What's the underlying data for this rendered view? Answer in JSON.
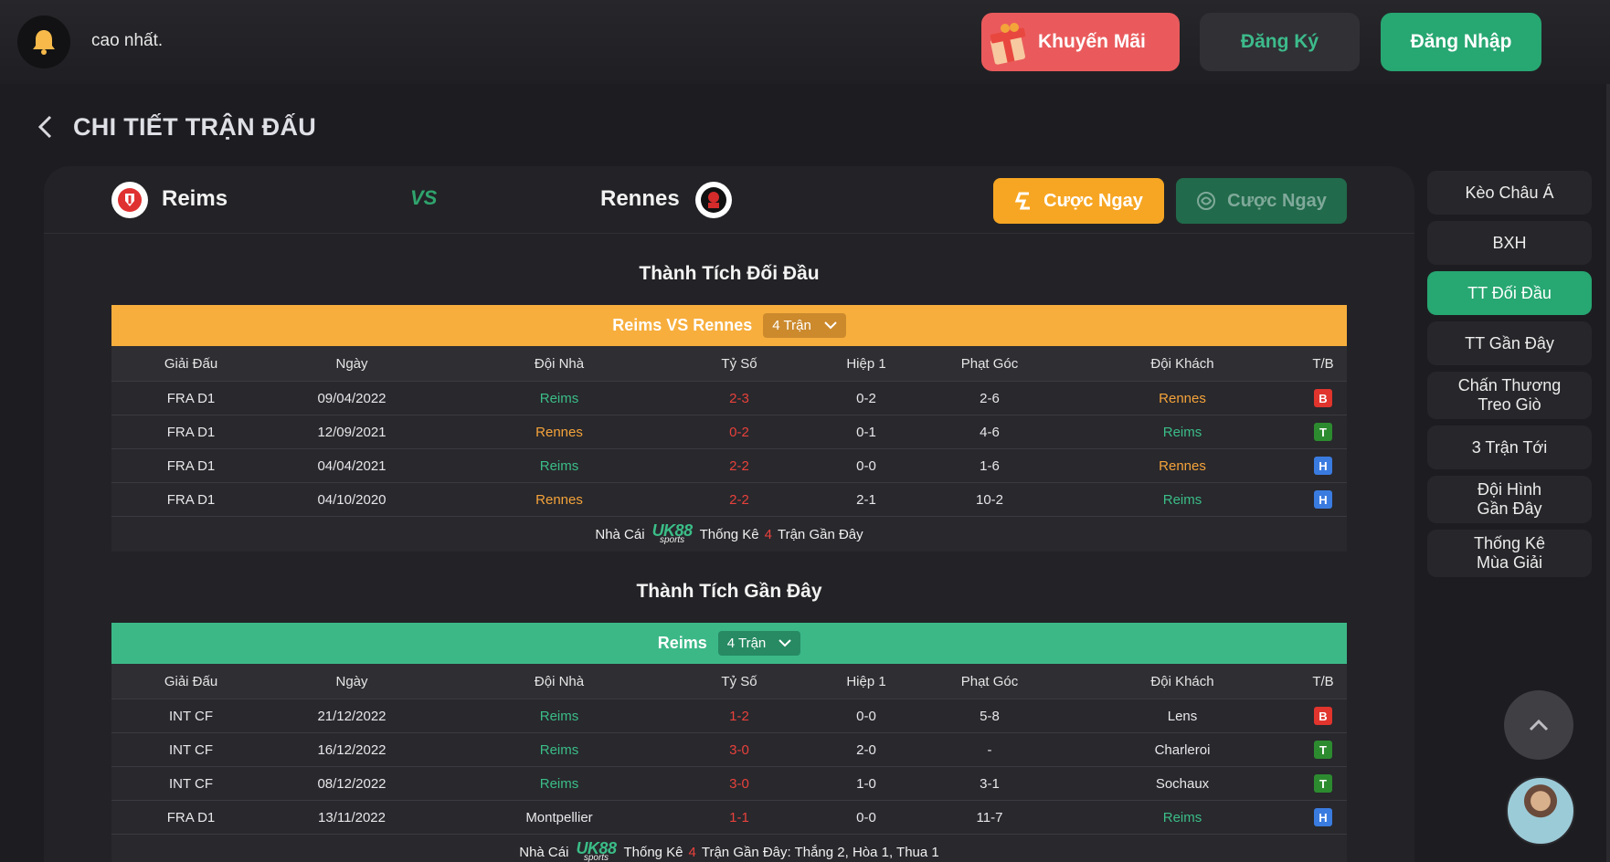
{
  "topbar": {
    "marquee": "cao nhất.",
    "promo_label": "Khuyến Mãi",
    "register_label": "Đăng Ký",
    "login_label": "Đăng Nhập"
  },
  "page": {
    "title": "CHI TIẾT TRẬN ĐẤU"
  },
  "match": {
    "home": "Reims",
    "away": "Rennes",
    "vs": "VS",
    "bet_now_1": "Cược Ngay",
    "bet_now_2": "Cược Ngay"
  },
  "h2h": {
    "title": "Thành Tích Đối Đầu",
    "band_label": "Reims VS Rennes",
    "count": "4 Trận",
    "columns": [
      "Giải Đấu",
      "Ngày",
      "Đội Nhà",
      "Tỷ Số",
      "Hiệp 1",
      "Phạt Góc",
      "Đội Khách",
      "T/B"
    ],
    "rows": [
      {
        "league": "FRA D1",
        "date": "09/04/2022",
        "home": "Reims",
        "score": "2-3",
        "ht": "0-2",
        "corners": "2-6",
        "away": "Rennes",
        "result": "B"
      },
      {
        "league": "FRA D1",
        "date": "12/09/2021",
        "home": "Rennes",
        "score": "0-2",
        "ht": "0-1",
        "corners": "4-6",
        "away": "Reims",
        "result": "T"
      },
      {
        "league": "FRA D1",
        "date": "04/04/2021",
        "home": "Reims",
        "score": "2-2",
        "ht": "0-0",
        "corners": "1-6",
        "away": "Rennes",
        "result": "H"
      },
      {
        "league": "FRA D1",
        "date": "04/10/2020",
        "home": "Rennes",
        "score": "2-2",
        "ht": "2-1",
        "corners": "10-2",
        "away": "Reims",
        "result": "H"
      }
    ],
    "footer_prefix": "Nhà Cái",
    "footer_logo": "UK88",
    "footer_logo_sub": "sports",
    "footer_mid": "Thống Kê",
    "footer_count": "4",
    "footer_suffix": "Trận Gần Đây"
  },
  "recent": {
    "title": "Thành Tích Gần Đây",
    "band_label": "Reims",
    "count": "4 Trận",
    "columns": [
      "Giải Đấu",
      "Ngày",
      "Đội Nhà",
      "Tỷ Số",
      "Hiệp 1",
      "Phạt Góc",
      "Đội Khách",
      "T/B"
    ],
    "rows": [
      {
        "league": "INT CF",
        "date": "21/12/2022",
        "home": "Reims",
        "score": "1-2",
        "ht": "0-0",
        "corners": "5-8",
        "away": "Lens",
        "result": "B"
      },
      {
        "league": "INT CF",
        "date": "16/12/2022",
        "home": "Reims",
        "score": "3-0",
        "ht": "2-0",
        "corners": "-",
        "away": "Charleroi",
        "result": "T"
      },
      {
        "league": "INT CF",
        "date": "08/12/2022",
        "home": "Reims",
        "score": "3-0",
        "ht": "1-0",
        "corners": "3-1",
        "away": "Sochaux",
        "result": "T"
      },
      {
        "league": "FRA D1",
        "date": "13/11/2022",
        "home": "Montpellier",
        "score": "1-1",
        "ht": "0-0",
        "corners": "11-7",
        "away": "Reims",
        "result": "H"
      }
    ],
    "footer_prefix": "Nhà Cái",
    "footer_logo": "UK88",
    "footer_logo_sub": "sports",
    "footer_mid": "Thống Kê",
    "footer_count": "4",
    "footer_suffix": "Trận Gần Đây: Thắng 2, Hòa 1, Thua 1"
  },
  "sidenav": [
    {
      "label": "Kèo Châu Á",
      "active": false
    },
    {
      "label": "BXH",
      "active": false
    },
    {
      "label": "TT Đối Đầu",
      "active": true
    },
    {
      "label": "TT Gần Đây",
      "active": false
    },
    {
      "label": "Chấn Thương\nTreo Giò",
      "active": false
    },
    {
      "label": "3 Trận Tới",
      "active": false
    },
    {
      "label": "Đội Hình\nGần Đây",
      "active": false
    },
    {
      "label": "Thống Kê\nMùa Giải",
      "active": false
    }
  ],
  "colors": {
    "accent_green": "#27a772",
    "accent_orange": "#f7ae3d",
    "promo_red": "#ea5a5c",
    "loss": "#e0342d",
    "win": "#2d8b2f",
    "draw": "#3a7be0"
  },
  "icons": [
    "bell-icon",
    "gift-icon",
    "chevron-left-icon",
    "chevron-down-icon",
    "chevron-up-icon",
    "reims-logo",
    "rennes-logo",
    "bet-icon"
  ]
}
